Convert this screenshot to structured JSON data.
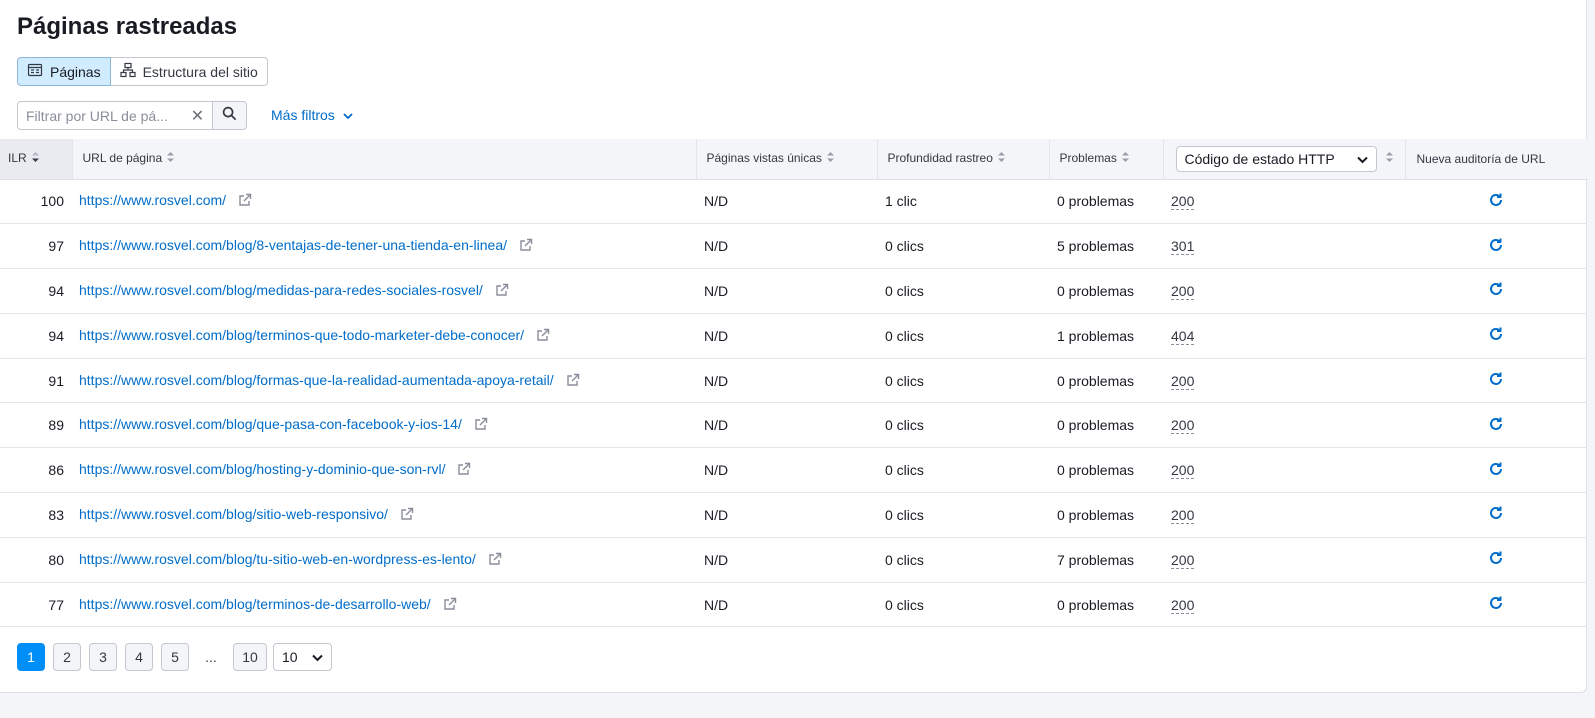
{
  "page": {
    "title": "Páginas rastreadas"
  },
  "view_toggle": {
    "pages_label": "Páginas",
    "structure_label": "Estructura del sitio"
  },
  "filter": {
    "placeholder": "Filtrar por URL de pá...",
    "more_filters_label": "Más filtros"
  },
  "table": {
    "headers": {
      "ilr": "ILR",
      "url": "URL de página",
      "unique_views": "Páginas vistas únicas",
      "depth": "Profundidad rastreo",
      "issues": "Problemas",
      "http": "Código de estado HTTP",
      "audit": "Nueva auditoría de URL"
    },
    "rows": [
      {
        "ilr": "100",
        "url": "https://www.rosvel.com/",
        "views": "N/D",
        "depth": "1 clic",
        "issues": "0 problemas",
        "code": "200"
      },
      {
        "ilr": "97",
        "url": "https://www.rosvel.com/blog/8-ventajas-de-tener-una-tienda-en-linea/",
        "views": "N/D",
        "depth": "0 clics",
        "issues": "5 problemas",
        "code": "301"
      },
      {
        "ilr": "94",
        "url": "https://www.rosvel.com/blog/medidas-para-redes-sociales-rosvel/",
        "views": "N/D",
        "depth": "0 clics",
        "issues": "0 problemas",
        "code": "200"
      },
      {
        "ilr": "94",
        "url": "https://www.rosvel.com/blog/terminos-que-todo-marketer-debe-conocer/",
        "views": "N/D",
        "depth": "0 clics",
        "issues": "1 problemas",
        "code": "404"
      },
      {
        "ilr": "91",
        "url": "https://www.rosvel.com/blog/formas-que-la-realidad-aumentada-apoya-retail/",
        "views": "N/D",
        "depth": "0 clics",
        "issues": "0 problemas",
        "code": "200"
      },
      {
        "ilr": "89",
        "url": "https://www.rosvel.com/blog/que-pasa-con-facebook-y-ios-14/",
        "views": "N/D",
        "depth": "0 clics",
        "issues": "0 problemas",
        "code": "200"
      },
      {
        "ilr": "86",
        "url": "https://www.rosvel.com/blog/hosting-y-dominio-que-son-rvl/",
        "views": "N/D",
        "depth": "0 clics",
        "issues": "0 problemas",
        "code": "200"
      },
      {
        "ilr": "83",
        "url": "https://www.rosvel.com/blog/sitio-web-responsivo/",
        "views": "N/D",
        "depth": "0 clics",
        "issues": "0 problemas",
        "code": "200"
      },
      {
        "ilr": "80",
        "url": "https://www.rosvel.com/blog/tu-sitio-web-en-wordpress-es-lento/",
        "views": "N/D",
        "depth": "0 clics",
        "issues": "7 problemas",
        "code": "200"
      },
      {
        "ilr": "77",
        "url": "https://www.rosvel.com/blog/terminos-de-desarrollo-web/",
        "views": "N/D",
        "depth": "0 clics",
        "issues": "0 problemas",
        "code": "200"
      }
    ]
  },
  "pagination": {
    "pages": [
      "1",
      "2",
      "3",
      "4",
      "5"
    ],
    "ellipsis": "...",
    "last": "10",
    "current": "1",
    "per_page": "10"
  },
  "colors": {
    "accent": "#008ff8",
    "link": "#006dca",
    "active_segment": "#d1ecff"
  },
  "icons": {
    "pages": "pages-icon",
    "structure": "sitemap-icon",
    "search": "search-icon",
    "clear": "close-icon",
    "external": "external-link-icon",
    "refresh": "refresh-icon"
  }
}
